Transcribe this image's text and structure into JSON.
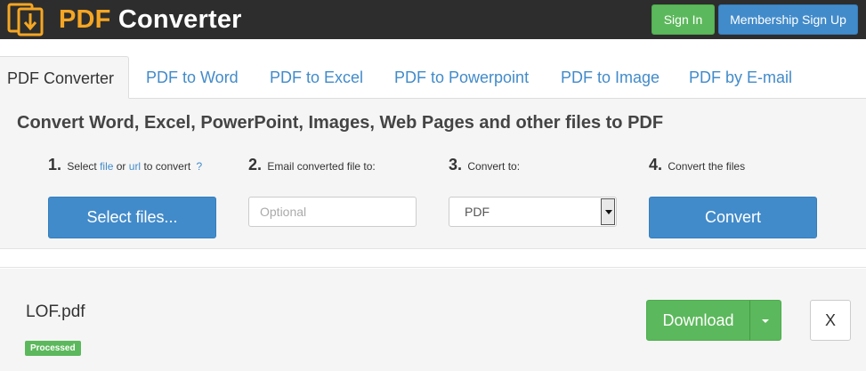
{
  "header": {
    "brand_accent": "PDF",
    "brand_rest": "Converter",
    "signin_label": "Sign In",
    "membership_label": "Membership Sign Up"
  },
  "tabs": [
    {
      "label": "PDF Converter",
      "active": true
    },
    {
      "label": "PDF to Word"
    },
    {
      "label": "PDF to Excel"
    },
    {
      "label": "PDF to Powerpoint"
    },
    {
      "label": "PDF to Image"
    },
    {
      "label": "PDF by E-mail"
    }
  ],
  "panel": {
    "title": "Convert Word, Excel, PowerPoint, Images, Web Pages and other files to PDF",
    "step1": {
      "num": "1.",
      "pre": "Select",
      "link_file": "file",
      "mid": "or",
      "link_url": "url",
      "post": "to convert",
      "help": "?"
    },
    "step2": {
      "num": "2.",
      "text": "Email converted file to:"
    },
    "step3": {
      "num": "3.",
      "text": "Convert to:"
    },
    "step4": {
      "num": "4.",
      "text": "Convert the files"
    },
    "select_files_label": "Select files...",
    "email_placeholder": "Optional",
    "convert_to_value": "PDF",
    "convert_label": "Convert"
  },
  "file": {
    "name": "LOF.pdf",
    "status": "Processed",
    "download_label": "Download",
    "remove_label": "X"
  },
  "colors": {
    "header_bg": "#2d2d2d",
    "brand_accent": "#f5a623",
    "primary": "#428bca",
    "success": "#5cb85c"
  }
}
